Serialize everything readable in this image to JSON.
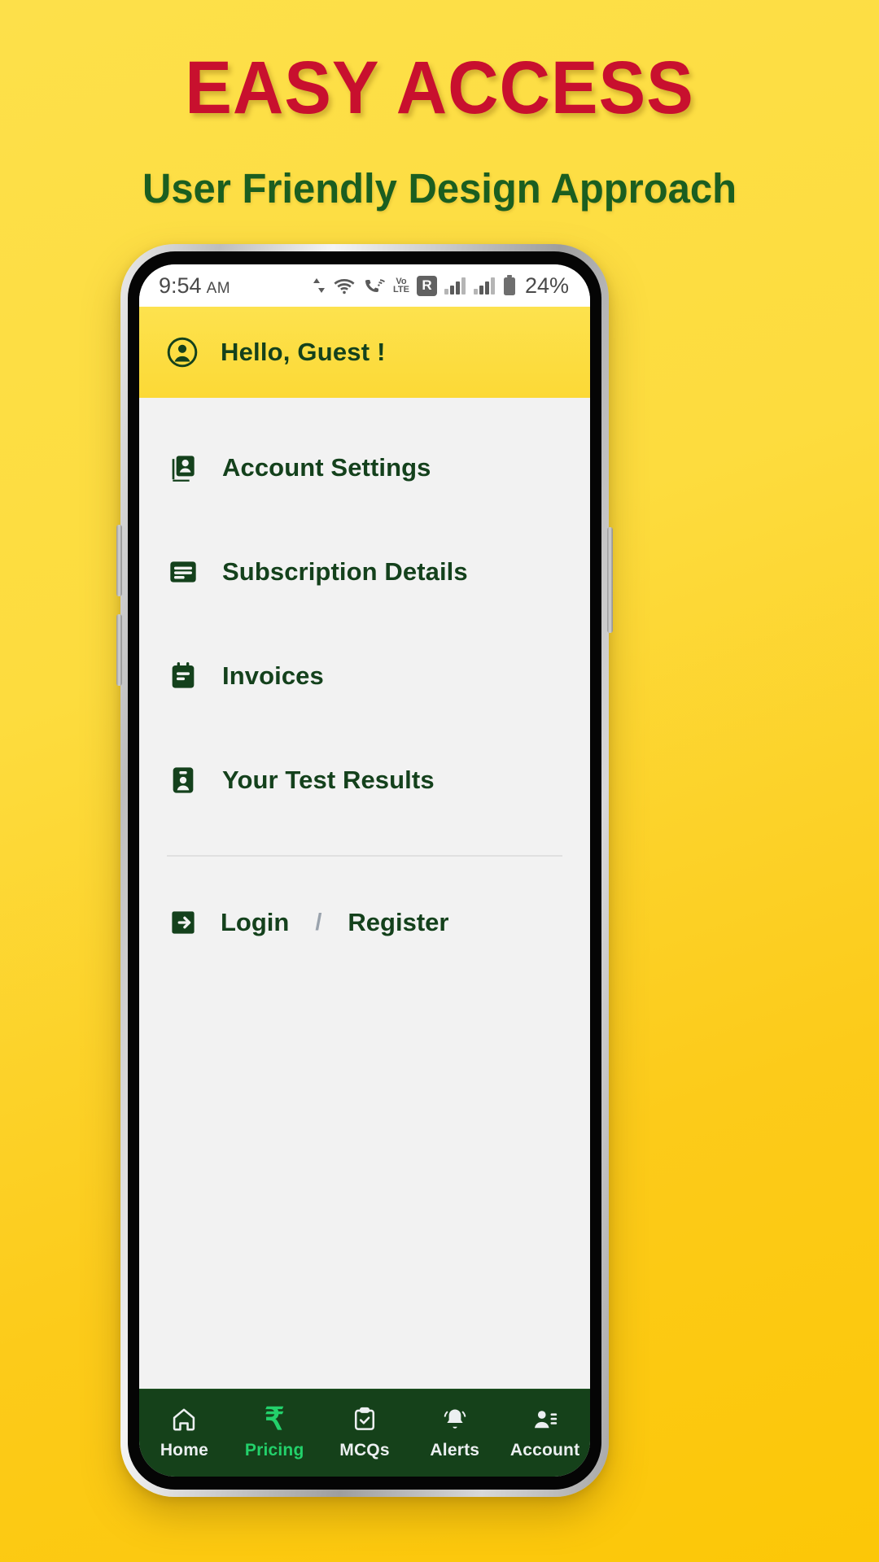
{
  "promo": {
    "title": "EASY ACCESS",
    "subtitle": "User Friendly Design Approach",
    "title_color": "#c8102e",
    "subtitle_color": "#1b5e20",
    "background_color": "#fdd835"
  },
  "status_bar": {
    "time": "9:54",
    "ampm": "AM",
    "roaming_badge": "R",
    "volte_top": "Vo",
    "volte_bottom": "LTE",
    "battery_percent": "24%",
    "icons": [
      "data-transfer-icon",
      "wifi-icon",
      "call-wifi-icon",
      "volte-icon",
      "roaming-icon",
      "signal-bars-icon",
      "signal-bars-icon",
      "battery-icon"
    ]
  },
  "header": {
    "greeting": "Hello, Guest !",
    "avatar_icon": "account-circle-icon",
    "background_color": "#fcd936",
    "text_color": "#14411c"
  },
  "menu": {
    "items": [
      {
        "label": "Account Settings",
        "icon": "contacts-icon"
      },
      {
        "label": "Subscription Details",
        "icon": "subscription-card-icon"
      },
      {
        "label": "Invoices",
        "icon": "invoice-clipboard-icon"
      },
      {
        "label": "Your Test Results",
        "icon": "id-badge-icon"
      }
    ]
  },
  "auth": {
    "icon": "login-arrow-icon",
    "login_label": "Login",
    "separator": "/",
    "register_label": "Register"
  },
  "bottom_nav": {
    "active": "Account",
    "accent_color": "#23d16b",
    "background_color": "#15411a",
    "items": [
      {
        "label": "Home",
        "icon": "home-icon"
      },
      {
        "label": "Pricing",
        "icon": "rupee-icon"
      },
      {
        "label": "MCQs",
        "icon": "clipboard-check-icon"
      },
      {
        "label": "Alerts",
        "icon": "bell-icon"
      },
      {
        "label": "Account",
        "icon": "account-list-icon"
      }
    ]
  }
}
